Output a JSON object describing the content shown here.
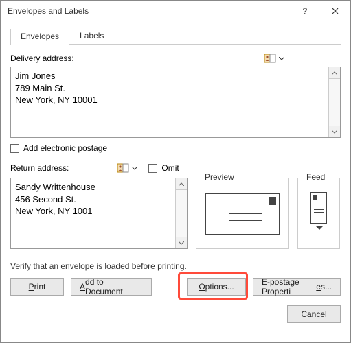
{
  "window": {
    "title": "Envelopes and Labels"
  },
  "tabs": {
    "envelopes": "Envelopes",
    "labels": "Labels"
  },
  "delivery": {
    "label": "Delivery address:",
    "text": "Jim Jones\n789 Main St.\nNew York, NY 10001"
  },
  "electronic_postage": {
    "label": "Add electronic postage"
  },
  "return": {
    "label": "Return address:",
    "omit_label": "Omit",
    "text": "Sandy Writtenhouse\n456 Second St.\nNew York, NY 1001"
  },
  "preview": {
    "legend": "Preview"
  },
  "feed": {
    "legend": "Feed"
  },
  "verify": {
    "text": "Verify that an envelope is loaded before printing."
  },
  "buttons": {
    "print_pre": "",
    "print_ul": "P",
    "print_post": "rint",
    "add_pre": "",
    "add_ul": "A",
    "add_post": "dd to Document",
    "options_pre": "",
    "options_ul": "O",
    "options_post": "ptions...",
    "ep_pre": "E-postage Properti",
    "ep_ul": "e",
    "ep_post": "s...",
    "cancel": "Cancel"
  }
}
